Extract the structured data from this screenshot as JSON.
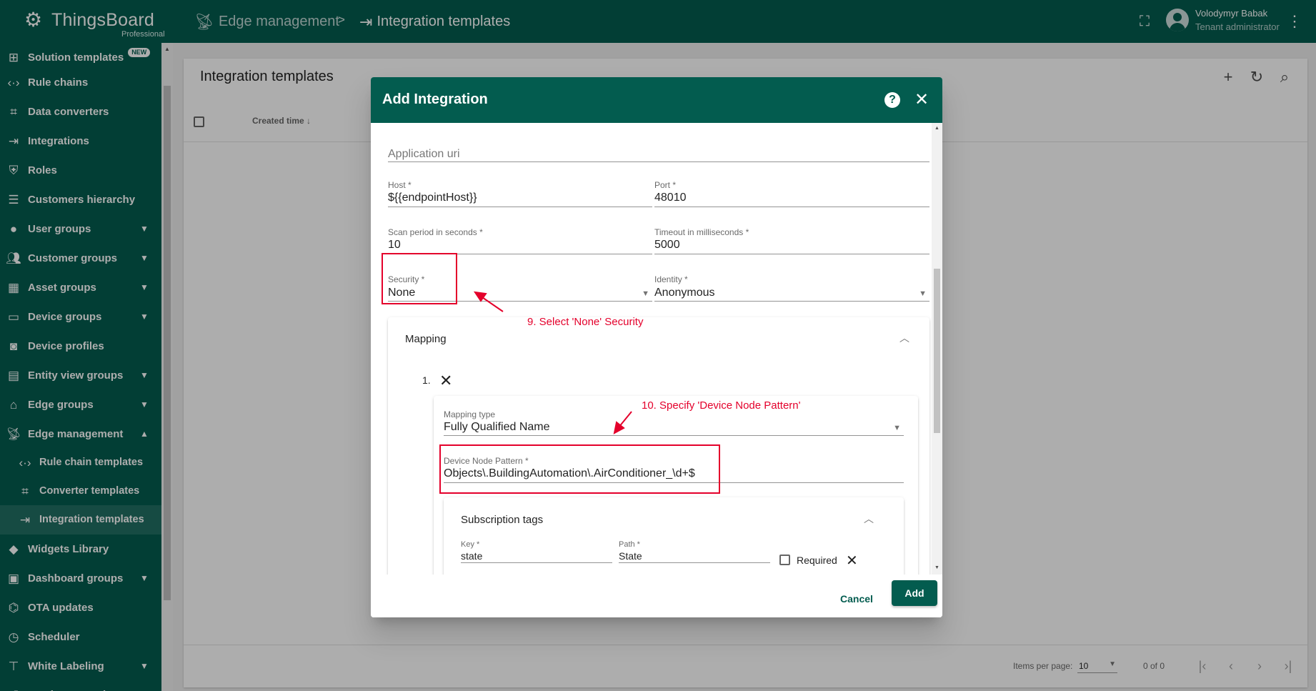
{
  "topbar": {
    "brand": "ThingsBoard",
    "brand_edition": "Professional",
    "breadcrumbs": [
      {
        "label": "Edge management",
        "icon": "edge-icon"
      },
      {
        "label": "Integration templates",
        "icon": "integration-icon"
      }
    ],
    "crumb_separator": ">",
    "user_name": "Volodymyr Babak",
    "user_role": "Tenant administrator"
  },
  "sidebar": {
    "items": [
      {
        "label": "Solution templates",
        "icon": "apps-grid-icon",
        "badge": "NEW"
      },
      {
        "label": "Rule chains",
        "icon": "code-arrows-icon"
      },
      {
        "label": "Data converters",
        "icon": "crop-icon"
      },
      {
        "label": "Integrations",
        "icon": "input-icon"
      },
      {
        "label": "Roles",
        "icon": "shield-icon"
      },
      {
        "label": "Customers hierarchy",
        "icon": "sort-lines-icon"
      },
      {
        "label": "User groups",
        "icon": "account-circle-icon",
        "chevron": "down"
      },
      {
        "label": "Customer groups",
        "icon": "supervisor-icon",
        "chevron": "down"
      },
      {
        "label": "Asset groups",
        "icon": "domain-icon",
        "chevron": "down"
      },
      {
        "label": "Device groups",
        "icon": "devices-icon",
        "chevron": "down"
      },
      {
        "label": "Device profiles",
        "icon": "device-profile-icon"
      },
      {
        "label": "Entity view groups",
        "icon": "view-quilt-icon",
        "chevron": "down"
      },
      {
        "label": "Edge groups",
        "icon": "router-icon",
        "chevron": "down"
      },
      {
        "label": "Edge management",
        "icon": "antenna-icon",
        "chevron": "up"
      },
      {
        "label": "Rule chain templates",
        "icon": "code-arrows-icon",
        "sub": true
      },
      {
        "label": "Converter templates",
        "icon": "crop-icon",
        "sub": true
      },
      {
        "label": "Integration templates",
        "icon": "input-icon",
        "sub": true,
        "selected": true
      },
      {
        "label": "Widgets Library",
        "icon": "widgets-icon"
      },
      {
        "label": "Dashboard groups",
        "icon": "dashboard-icon",
        "chevron": "down"
      },
      {
        "label": "OTA updates",
        "icon": "memory-icon"
      },
      {
        "label": "Scheduler",
        "icon": "schedule-icon"
      },
      {
        "label": "White Labeling",
        "icon": "format-paint-icon",
        "chevron": "down"
      },
      {
        "label": "Version control",
        "icon": "history-icon"
      }
    ]
  },
  "page": {
    "title": "Integration templates",
    "column_created": "Created time",
    "items_per_page_label": "Items per page:",
    "items_per_page_value": "10",
    "range_label": "0 of 0"
  },
  "dialog": {
    "title": "Add Integration",
    "application_uri": {
      "placeholder": "Application uri"
    },
    "host": {
      "label": "Host *",
      "value": "${{endpointHost}}"
    },
    "port": {
      "label": "Port *",
      "value": "48010"
    },
    "scan_period": {
      "label": "Scan period in seconds *",
      "value": "10"
    },
    "timeout": {
      "label": "Timeout in milliseconds *",
      "value": "5000"
    },
    "security": {
      "label": "Security *",
      "value": "None"
    },
    "identity": {
      "label": "Identity *",
      "value": "Anonymous"
    },
    "mapping": {
      "title": "Mapping",
      "entry_number": "1.",
      "mapping_type": {
        "label": "Mapping type",
        "value": "Fully Qualified Name"
      },
      "device_node_pattern": {
        "label": "Device Node Pattern *",
        "value": "Objects\\.BuildingAutomation\\.AirConditioner_\\d+$"
      },
      "subscription_tags": {
        "title": "Subscription tags",
        "key": {
          "label": "Key *",
          "value": "state"
        },
        "path": {
          "label": "Path *",
          "value": "State"
        },
        "required_label": "Required"
      }
    },
    "cancel_label": "Cancel",
    "add_label": "Add"
  },
  "annotations": {
    "step9": "9. Select 'None' Security",
    "step10": "10. Specify 'Device Node Pattern'",
    "color": "#e4002b"
  },
  "colors": {
    "primary": "#035c4f",
    "page_bg": "#eeeeee"
  }
}
